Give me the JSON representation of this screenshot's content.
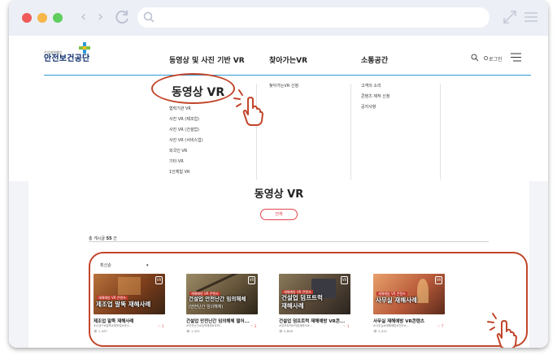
{
  "colors": {
    "accent": "#e1464c",
    "annotation": "#c2452a",
    "header_line": "#2f9bd3",
    "brand_navy": "#0b2d6b"
  },
  "browser": {
    "traffic_lights": [
      "#f05a5a",
      "#f6b64a",
      "#5fce5f"
    ],
    "icons": [
      "back-icon",
      "forward-icon",
      "reload-icon",
      "search-icon",
      "expand-icon",
      "menu-icon"
    ]
  },
  "header": {
    "logo_small": "산업재해예방",
    "logo_main": "안전보건공단",
    "nav": [
      "동영상 및 사진 기반 VR",
      "찾아가는VR",
      "소통공간"
    ],
    "login": "로그인"
  },
  "mega_menu": {
    "title": "동영상 VR",
    "col1": [
      "협력기관 VR",
      "사진 VR (제조업)",
      "사진 VR (건설업)",
      "사진 VR (서비스업)",
      "외국인 VR",
      "기타 VR",
      "1인체험 VR"
    ],
    "col2": [
      "찾아가는VR 신청"
    ],
    "col3": [
      "고객의 소리",
      "콘텐츠 제작 신청",
      "공지사항"
    ]
  },
  "content": {
    "title": "동영상 VR",
    "filter": "전체",
    "total_prefix": "총 게시글",
    "total_count": "55",
    "total_suffix": "건",
    "sort": "최신순"
  },
  "cards": [
    {
      "badge": "재해예방 VR 콘텐츠",
      "caption": "제조업 말뚝 재해사례",
      "caption2": "",
      "title": "제조업 말뚝 재해사례",
      "tags": "#수공구#말뚝#제조업#운수...",
      "views": "1,497",
      "likes": "1",
      "bg": "#8a4a22"
    },
    {
      "badge": "재해예방 VR 콘텐츠",
      "caption": "건설업 안전난간 임의해체",
      "caption2": "(안전난간 임의해체)",
      "title": "건설업 안전난간 임의해체 떨어...",
      "tags": "#안전난간#임의해체#추락...",
      "views": "1,351",
      "likes": "2",
      "bg": "#7c6a4a"
    },
    {
      "badge": "재해예방 VR 콘텐츠",
      "caption": "건설업 덤프트럭",
      "caption2": "재해사례",
      "title": "건설업 덤프트럭 재해예방 VR콘...",
      "tags": "#덤프트럭#작업계획서#...",
      "views": "2,606",
      "likes": "1",
      "bg": "#5b4a3a"
    },
    {
      "badge": "재해예방 VR 콘텐츠",
      "caption": "사무실 재해사례",
      "caption2": "",
      "title": "사무실 재해예방 VR콘텐츠",
      "tags": "#사무실#재해예방#전도#...",
      "views": "2,412",
      "likes": "7",
      "bg": "#a0503a"
    }
  ]
}
